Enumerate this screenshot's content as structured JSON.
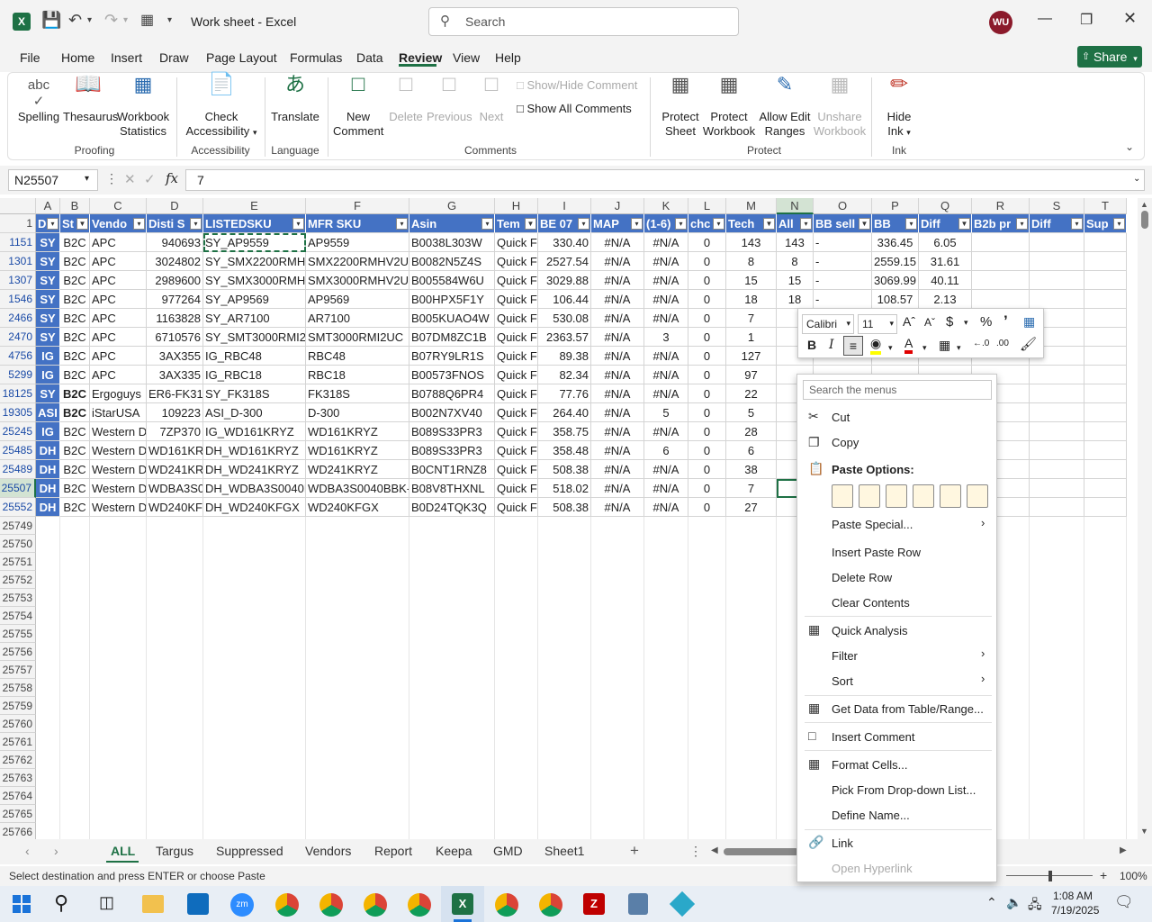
{
  "titlebar": {
    "title": "Work sheet  -  Excel",
    "search_placeholder": "Search",
    "avatar": "WU"
  },
  "menu": [
    "File",
    "Home",
    "Insert",
    "Draw",
    "Page Layout",
    "Formulas",
    "Data",
    "Review",
    "View",
    "Help"
  ],
  "share": "Share",
  "ribbon": {
    "spelling": "Spelling",
    "thesaurus": "Thesaurus",
    "workbook_stats_1": "Workbook",
    "workbook_stats_2": "Statistics",
    "check_acc_1": "Check",
    "check_acc_2": "Accessibility",
    "translate": "Translate",
    "new_comment_1": "New",
    "new_comment_2": "Comment",
    "delete": "Delete",
    "previous": "Previous",
    "next": "Next",
    "show_hide_comment": "Show/Hide Comment",
    "show_all_comments": "Show All Comments",
    "protect_sheet_1": "Protect",
    "protect_sheet_2": "Sheet",
    "protect_wb_1": "Protect",
    "protect_wb_2": "Workbook",
    "allow_edit_1": "Allow Edit",
    "allow_edit_2": "Ranges",
    "unshare_1": "Unshare",
    "unshare_2": "Workbook",
    "hide_ink_1": "Hide",
    "hide_ink_2": "Ink",
    "groups": {
      "proofing": "Proofing",
      "accessibility": "Accessibility",
      "language": "Language",
      "comments": "Comments",
      "protect": "Protect",
      "ink": "Ink"
    }
  },
  "formula": {
    "namebox": "N25507",
    "value": "7"
  },
  "columns": [
    "A",
    "B",
    "C",
    "D",
    "E",
    "F",
    "G",
    "H",
    "I",
    "J",
    "K",
    "L",
    "M",
    "N",
    "O",
    "P",
    "Q",
    "R",
    "S",
    "T"
  ],
  "headers": [
    "D",
    "St",
    "Vendo",
    "Disti S",
    "LISTEDSKU",
    "MFR SKU",
    "Asin",
    "Tem",
    "BE 07",
    "MAP",
    "(1-6)",
    "chc",
    "Tech",
    "All",
    "BB sell",
    "BB",
    "Diff",
    "B2b pr",
    "Diff",
    "Sup"
  ],
  "rows": [
    {
      "rn": "1151",
      "c": [
        "SY",
        "B2C",
        "APC",
        "940693",
        "SY_AP9559",
        "AP9559",
        "B0038L303W",
        "Quick F",
        "330.40",
        "#N/A",
        "#N/A",
        "0",
        "143",
        "143",
        "-",
        "336.45",
        "6.05",
        "",
        "",
        ""
      ]
    },
    {
      "rn": "1301",
      "c": [
        "SY",
        "B2C",
        "APC",
        "3024802",
        "SY_SMX2200RMHV",
        "SMX2200RMHV2U",
        "B0082N5Z4S",
        "Quick F",
        "2527.54",
        "#N/A",
        "#N/A",
        "0",
        "8",
        "8",
        "-",
        "2559.15",
        "31.61",
        "",
        "",
        ""
      ]
    },
    {
      "rn": "1307",
      "c": [
        "SY",
        "B2C",
        "APC",
        "2989600",
        "SY_SMX3000RMHV",
        "SMX3000RMHV2U",
        "B005584W6U",
        "Quick F",
        "3029.88",
        "#N/A",
        "#N/A",
        "0",
        "15",
        "15",
        "-",
        "3069.99",
        "40.11",
        "",
        "",
        ""
      ]
    },
    {
      "rn": "1546",
      "c": [
        "SY",
        "B2C",
        "APC",
        "977264",
        "SY_AP9569",
        "AP9569",
        "B00HPX5F1Y",
        "Quick F",
        "106.44",
        "#N/A",
        "#N/A",
        "0",
        "18",
        "18",
        "-",
        "108.57",
        "2.13",
        "",
        "",
        ""
      ]
    },
    {
      "rn": "2466",
      "c": [
        "SY",
        "B2C",
        "APC",
        "1163828",
        "SY_AR7100",
        "AR7100",
        "B005KUAO4W",
        "Quick F",
        "530.08",
        "#N/A",
        "#N/A",
        "0",
        "7",
        "",
        "",
        "",
        "",
        "",
        "",
        ""
      ]
    },
    {
      "rn": "2470",
      "c": [
        "SY",
        "B2C",
        "APC",
        "6710576",
        "SY_SMT3000RMI2U",
        "SMT3000RMI2UC",
        "B07DM8ZC1B",
        "Quick F",
        "2363.57",
        "#N/A",
        "3",
        "0",
        "1",
        "",
        "",
        "",
        "",
        "",
        "",
        ""
      ]
    },
    {
      "rn": "4756",
      "c": [
        "IG",
        "B2C",
        "APC",
        "3AX355",
        "IG_RBC48",
        "RBC48",
        "B07RY9LR1S",
        "Quick F",
        "89.38",
        "#N/A",
        "#N/A",
        "0",
        "127",
        "",
        "",
        "",
        "",
        "",
        "",
        ""
      ]
    },
    {
      "rn": "5299",
      "c": [
        "IG",
        "B2C",
        "APC",
        "3AX335",
        "IG_RBC18",
        "RBC18",
        "B00573FNOS",
        "Quick F",
        "82.34",
        "#N/A",
        "#N/A",
        "0",
        "97",
        "",
        "",
        "",
        "",
        "",
        "",
        ""
      ]
    },
    {
      "rn": "18125",
      "c": [
        "SY",
        "B2C",
        "Ergoguys",
        "ER6-FK318",
        "SY_FK318S",
        "FK318S",
        "B0788Q6PR4",
        "Quick F",
        "77.76",
        "#N/A",
        "#N/A",
        "0",
        "22",
        "",
        "",
        "",
        "",
        "",
        "",
        ""
      ]
    },
    {
      "rn": "19305",
      "c": [
        "ASI",
        "B2C",
        "iStarUSA",
        "109223",
        "ASI_D-300",
        "D-300",
        "B002N7XV40",
        "Quick F",
        "264.40",
        "#N/A",
        "5",
        "0",
        "5",
        "",
        "",
        "",
        "",
        "",
        "",
        ""
      ]
    },
    {
      "rn": "25245",
      "c": [
        "IG",
        "B2C",
        "Western D",
        "7ZP370",
        "IG_WD161KRYZ",
        "WD161KRYZ",
        "B089S33PR3",
        "Quick F",
        "358.75",
        "#N/A",
        "#N/A",
        "0",
        "28",
        "",
        "",
        "",
        "",
        "",
        "",
        ""
      ]
    },
    {
      "rn": "25485",
      "c": [
        "DH",
        "B2C",
        "Western D",
        "WD161KR",
        "DH_WD161KRYZ",
        "WD161KRYZ",
        "B089S33PR3",
        "Quick F",
        "358.48",
        "#N/A",
        "6",
        "0",
        "6",
        "",
        "",
        "",
        "",
        "",
        "",
        ""
      ]
    },
    {
      "rn": "25489",
      "c": [
        "DH",
        "B2C",
        "Western D",
        "WD241KR",
        "DH_WD241KRYZ",
        "WD241KRYZ",
        "B0CNT1RNZ8",
        "Quick F",
        "508.38",
        "#N/A",
        "#N/A",
        "0",
        "38",
        "",
        "",
        "",
        "",
        "",
        "",
        ""
      ]
    },
    {
      "rn": "25507",
      "c": [
        "DH",
        "B2C",
        "Western D",
        "WDBA3S0",
        "DH_WDBA3S0040B",
        "WDBA3S0040BBK-",
        "B08V8THXNL",
        "Quick F",
        "518.02",
        "#N/A",
        "#N/A",
        "0",
        "7",
        "",
        "",
        "",
        "",
        "",
        "",
        ""
      ]
    },
    {
      "rn": "25552",
      "c": [
        "DH",
        "B2C",
        "Western D",
        "WD240KF",
        "DH_WD240KFGX",
        "WD240KFGX",
        "B0D24TQK3Q",
        "Quick F",
        "508.38",
        "#N/A",
        "#N/A",
        "0",
        "27",
        "",
        "",
        "",
        "",
        "",
        "",
        ""
      ]
    }
  ],
  "empty_rows": [
    "25749",
    "25750",
    "25751",
    "25752",
    "25753",
    "25754",
    "25755",
    "25756",
    "25757",
    "25758",
    "25759",
    "25760",
    "25761",
    "25762",
    "25763",
    "25764",
    "25765",
    "25766"
  ],
  "sheets": [
    "ALL",
    "Targus",
    "Suppressed",
    "Vendors",
    "Report",
    "Keepa",
    "GMD",
    "Sheet1"
  ],
  "status": {
    "text": "Select destination and press ENTER or choose Paste",
    "zoom": "100%"
  },
  "minitoolbar": {
    "font": "Calibri",
    "size": "11"
  },
  "context": {
    "search": "Search the menus",
    "cut": "Cut",
    "copy": "Copy",
    "paste_options": "Paste Options:",
    "paste_special": "Paste Special...",
    "insert_paste_row": "Insert Paste Row",
    "delete_row": "Delete Row",
    "clear_contents": "Clear Contents",
    "quick_analysis": "Quick Analysis",
    "filter": "Filter",
    "sort": "Sort",
    "get_data": "Get Data from Table/Range...",
    "insert_comment": "Insert Comment",
    "format_cells": "Format Cells...",
    "pick_list": "Pick From Drop-down List...",
    "define_name": "Define Name...",
    "link": "Link",
    "open_hyperlink": "Open Hyperlink"
  },
  "clock": {
    "time": "1:08 AM",
    "date": "7/19/2025"
  },
  "colors": {
    "accent": "#1e7145",
    "header_blue": "#4472c4",
    "avatar": "#8b1a2b"
  }
}
